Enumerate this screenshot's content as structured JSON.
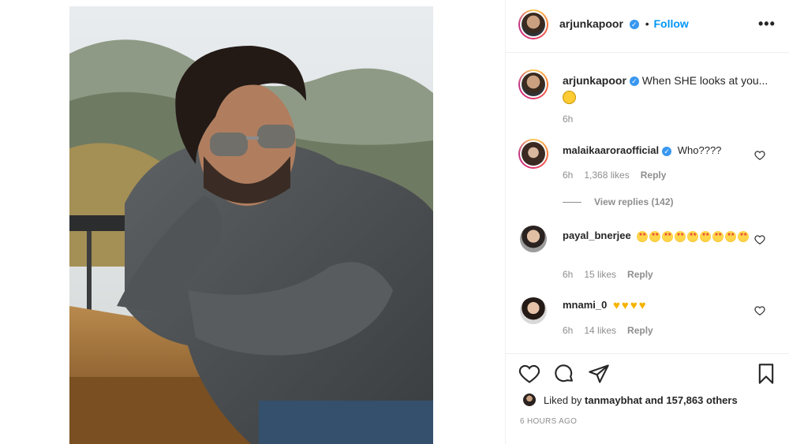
{
  "post": {
    "author": "arjunkapoor",
    "follow_label": "Follow",
    "separator": "•",
    "more_icon": "more-horizontal-icon",
    "caption": "When SHE looks at you...",
    "caption_emoji": "smiling-face-emoji",
    "caption_time": "6h"
  },
  "comments": [
    {
      "user": "malaikaaroraofficial",
      "verified": true,
      "text": "Who????",
      "time": "6h",
      "likes": "1,368 likes",
      "reply": "Reply",
      "view_replies": "View replies (142)"
    },
    {
      "user": "payal_bnerjee",
      "verified": false,
      "emoji": "star-struck-emoji x9",
      "time": "6h",
      "likes": "15 likes",
      "reply": "Reply"
    },
    {
      "user": "mnami_0",
      "verified": false,
      "emoji": "yellow-heart-emoji x4",
      "time": "6h",
      "likes": "14 likes",
      "reply": "Reply"
    }
  ],
  "actions": {
    "like_icon": "heart-outline-icon",
    "comment_icon": "comment-icon",
    "share_icon": "send-icon",
    "save_icon": "bookmark-icon"
  },
  "likes_line": {
    "prefix": "Liked by",
    "user": "tanmaybhat",
    "suffix": "and 157,863 others"
  },
  "timestamp": "6 HOURS AGO",
  "colors": {
    "verified_blue": "#3897f0",
    "follow_blue": "#0095f6",
    "meta_gray": "#8e8e8e"
  }
}
